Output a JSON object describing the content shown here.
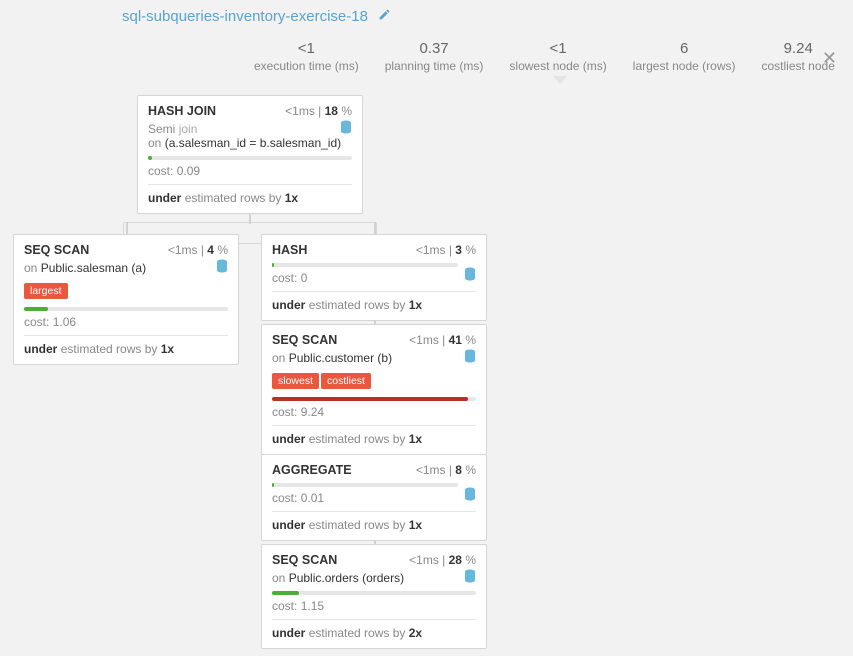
{
  "title": "sql-subqueries-inventory-exercise-18",
  "metrics": {
    "exec_time_val": "<1",
    "exec_time_lbl": "execution time (ms)",
    "plan_time_val": "0.37",
    "plan_time_lbl": "planning time (ms)",
    "slowest_val": "<1",
    "slowest_lbl": "slowest node (ms)",
    "largest_val": "6",
    "largest_lbl": "largest node (rows)",
    "costliest_val": "9.24",
    "costliest_lbl": "costliest node"
  },
  "nodes": {
    "hashjoin": {
      "title": "HASH JOIN",
      "timing_ms": "<1ms",
      "pct": "18",
      "sub_prefix": "Semi",
      "sub_join": "join",
      "cond_prefix": "on",
      "cond": "(a.salesman_id = b.salesman_id)",
      "cost_lbl": "cost:",
      "cost": "0.09",
      "est_w1": "under",
      "est_mid": "estimated rows by",
      "est_x": "1x"
    },
    "seqscan_a": {
      "title": "SEQ SCAN",
      "timing_ms": "<1ms",
      "pct": "4",
      "on_lbl": "on",
      "on": "Public.salesman (a)",
      "badge1": "largest",
      "cost_lbl": "cost:",
      "cost": "1.06",
      "est_w1": "under",
      "est_mid": "estimated rows by",
      "est_x": "1x"
    },
    "hash": {
      "title": "HASH",
      "timing_ms": "<1ms",
      "pct": "3",
      "cost_lbl": "cost:",
      "cost": "0",
      "est_w1": "under",
      "est_mid": "estimated rows by",
      "est_x": "1x"
    },
    "seqscan_b": {
      "title": "SEQ SCAN",
      "timing_ms": "<1ms",
      "pct": "41",
      "on_lbl": "on",
      "on": "Public.customer (b)",
      "badge1": "slowest",
      "badge2": "costliest",
      "cost_lbl": "cost:",
      "cost": "9.24",
      "est_w1": "under",
      "est_mid": "estimated rows by",
      "est_x": "1x"
    },
    "aggregate": {
      "title": "AGGREGATE",
      "timing_ms": "<1ms",
      "pct": "8",
      "cost_lbl": "cost:",
      "cost": "0.01",
      "est_w1": "under",
      "est_mid": "estimated rows by",
      "est_x": "1x"
    },
    "seqscan_orders": {
      "title": "SEQ SCAN",
      "timing_ms": "<1ms",
      "pct": "28",
      "on_lbl": "on",
      "on": "Public.orders (orders)",
      "cost_lbl": "cost:",
      "cost": "1.15",
      "est_w1": "under",
      "est_mid": "estimated rows by",
      "est_x": "2x"
    }
  }
}
